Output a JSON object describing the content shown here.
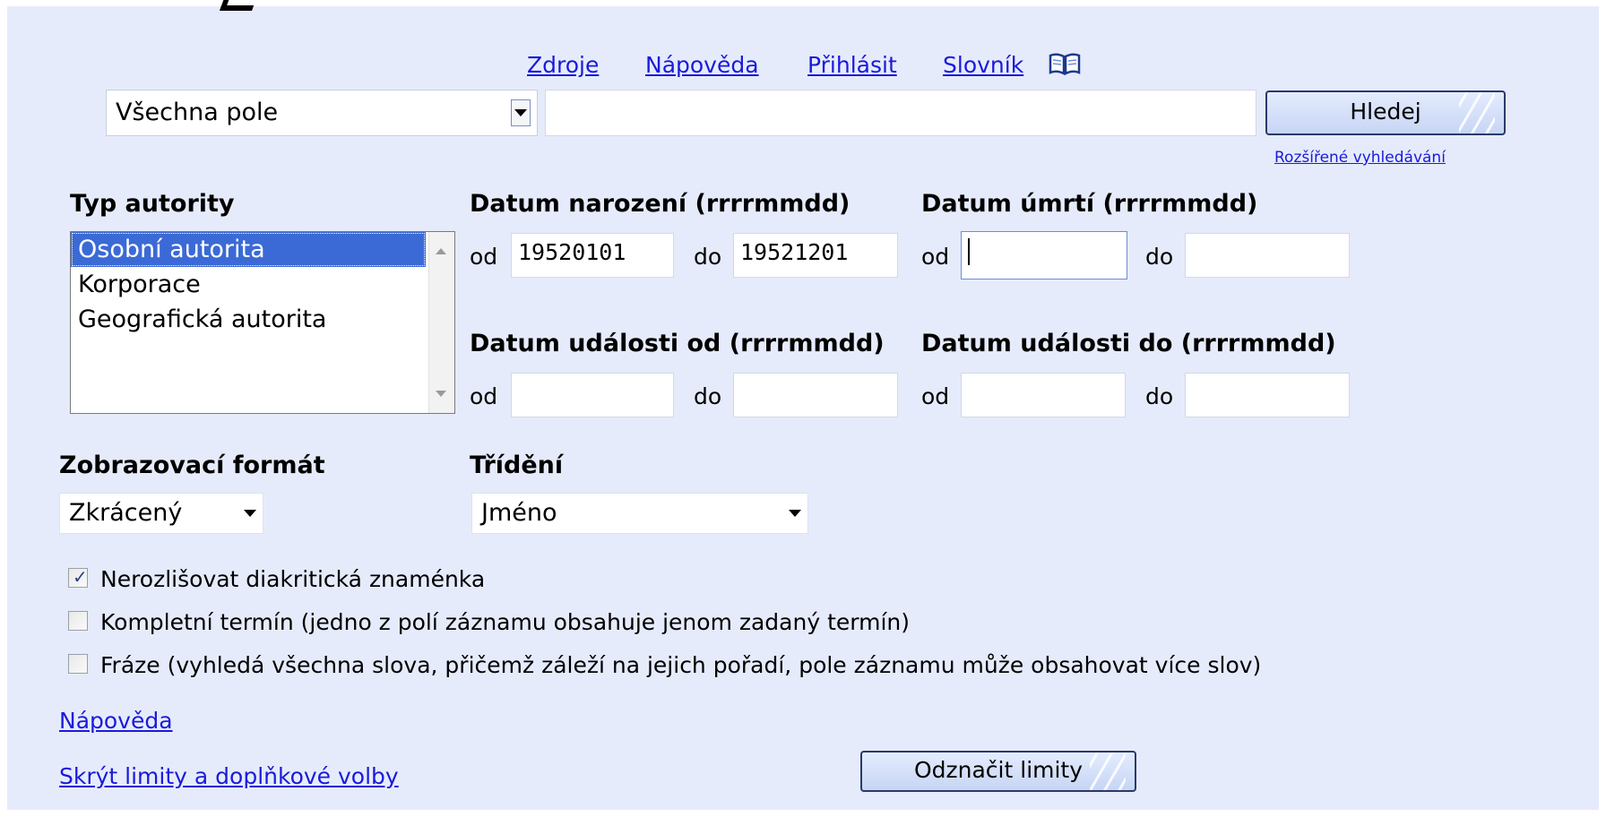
{
  "top_links": [
    "Zdroje",
    "Nápověda",
    "Přihlásit",
    "Slovník"
  ],
  "search": {
    "field_select": "Všechna pole",
    "query": "",
    "button": "Hledej",
    "advanced_link": "Rozšířené vyhledávání"
  },
  "authority_type": {
    "label": "Typ autority",
    "options": [
      "Osobní autorita",
      "Korporace",
      "Geografická autorita"
    ],
    "selected": "Osobní autorita"
  },
  "birth_date": {
    "label": "Datum narození (rrrrmmdd)",
    "from_label": "od",
    "to_label": "do",
    "from": "19520101",
    "to": "19521201"
  },
  "death_date": {
    "label": "Datum úmrtí (rrrrmmdd)",
    "from_label": "od",
    "to_label": "do",
    "from": "",
    "to": ""
  },
  "event_from": {
    "label": "Datum události od (rrrrmmdd)",
    "from_label": "od",
    "to_label": "do",
    "from": "",
    "to": ""
  },
  "event_to": {
    "label": "Datum události do (rrrrmmdd)",
    "from_label": "od",
    "to_label": "do",
    "from": "",
    "to": ""
  },
  "display_format": {
    "label": "Zobrazovací formát",
    "value": "Zkrácený"
  },
  "sorting": {
    "label": "Třídění",
    "value": "Jméno"
  },
  "options": [
    {
      "label": "Nerozlišovat diakritická znaménka",
      "checked": true
    },
    {
      "label": "Kompletní termín (jedno z polí záznamu obsahuje jenom zadaný termín)",
      "checked": false
    },
    {
      "label": "Fráze (vyhledá všechna slova, přičemž záleží na jejich pořadí, pole záznamu může obsahovat více slov)",
      "checked": false
    }
  ],
  "help_link": "Nápověda",
  "hide_limits_link": "Skrýt limity a doplňkové volby",
  "clear_limits_button": "Odznačit limity",
  "icons": {
    "dictionary": "open-book-icon"
  },
  "colors": {
    "panel_bg": "#e6ebfb",
    "link": "#1a1adb",
    "selection": "#3b6ad6"
  }
}
